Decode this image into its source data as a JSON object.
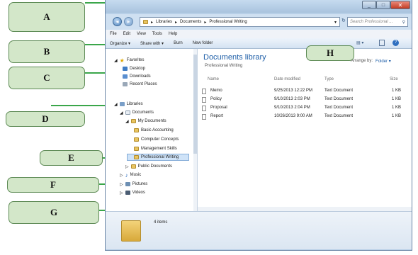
{
  "callouts": {
    "a": "A",
    "b": "B",
    "c": "C",
    "d": "D",
    "e": "E",
    "f": "F",
    "g": "G",
    "h": "H"
  },
  "window": {
    "address_parts": [
      "Libraries",
      "Documents",
      "Professional Writing"
    ],
    "search_placeholder": "Search Professional ...",
    "menu": [
      "File",
      "Edit",
      "View",
      "Tools",
      "Help"
    ],
    "toolbar": [
      "Organize ▾",
      "Share with ▾",
      "Burn",
      "New folder"
    ]
  },
  "nav": {
    "favorites": "Favorites",
    "desktop": "Desktop",
    "downloads": "Downloads",
    "recent": "Recent Places",
    "libraries": "Libraries",
    "documents": "Documents",
    "my_documents": "My Documents",
    "basic_accounting": "Basic Accounting",
    "computer_concepts": "Computer Concepts",
    "management_skills": "Management Skills",
    "professional_writing": "Professional Writing",
    "public_documents": "Public Documents",
    "music": "Music",
    "pictures": "Pictures",
    "videos": "Videos"
  },
  "library": {
    "title": "Documents library",
    "subtitle": "Professional Writing",
    "arrange_label": "Arrange by:",
    "arrange_value": "Folder ▾"
  },
  "columns": {
    "name": "Name",
    "date": "Date modified",
    "type": "Type",
    "size": "Size"
  },
  "files": [
    {
      "name": "Memo",
      "date": "9/25/2013 12:22 PM",
      "type": "Text Document",
      "size": "1 KB"
    },
    {
      "name": "Policy",
      "date": "9/10/2013 2:03 PM",
      "type": "Text Document",
      "size": "1 KB"
    },
    {
      "name": "Proposal",
      "date": "9/10/2013 2:04 PM",
      "type": "Text Document",
      "size": "1 KB"
    },
    {
      "name": "Report",
      "date": "10/26/2013 9:00 AM",
      "type": "Text Document",
      "size": "1 KB"
    }
  ],
  "details": {
    "count": "4 items"
  },
  "colors": {
    "callout_fill": "#d3e7c9",
    "leader": "#3aa64a",
    "window_chrome": "#b7cfe7",
    "library_title": "#1f5fa8"
  }
}
